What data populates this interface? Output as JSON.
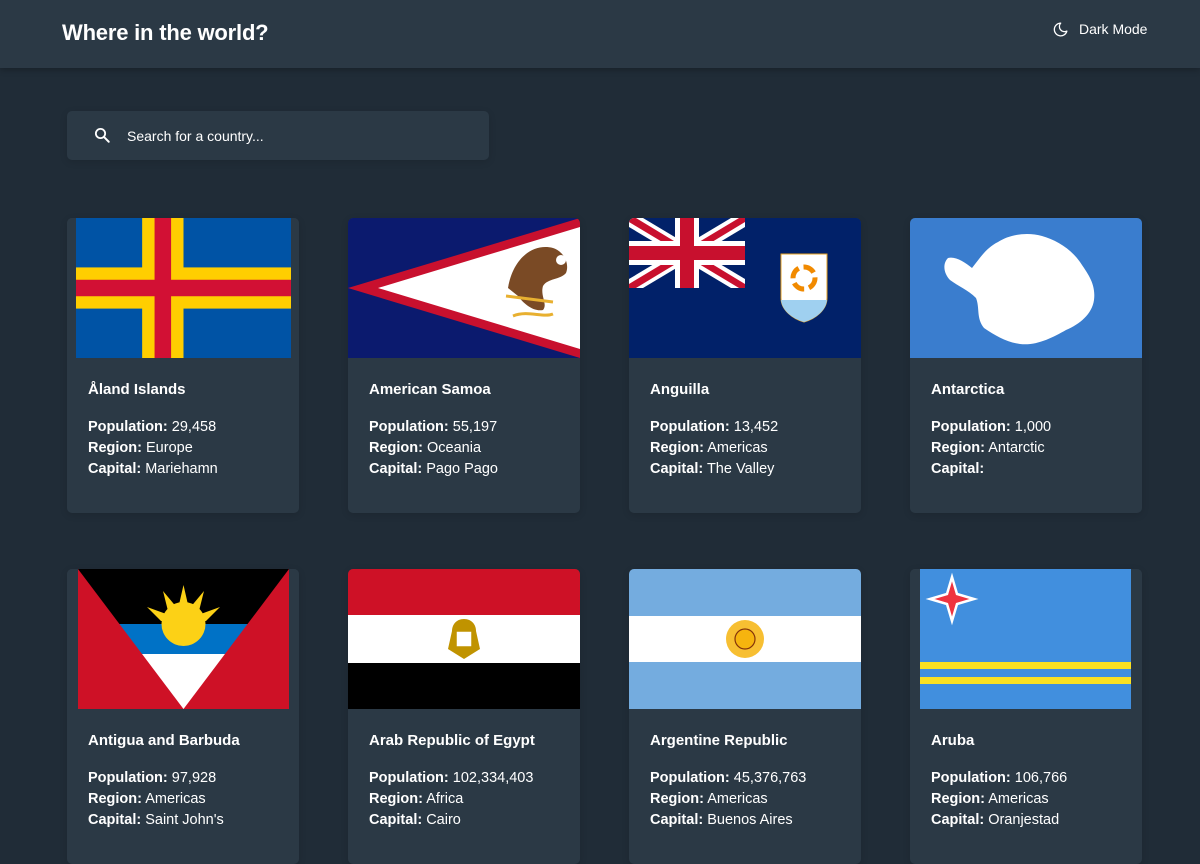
{
  "header": {
    "title": "Where in the world?",
    "mode_label": "Dark Mode",
    "mode_icon": "moon-icon"
  },
  "search": {
    "placeholder": "Search for a country...",
    "value": "",
    "icon": "search-icon"
  },
  "labels": {
    "population": "Population:",
    "region": "Region:",
    "capital": "Capital:"
  },
  "colors": {
    "background": "#202c37",
    "elements": "#2b3945",
    "text": "#ffffff"
  },
  "countries": [
    {
      "name": "Åland Islands",
      "population": "29,458",
      "region": "Europe",
      "capital": "Mariehamn",
      "flag": "aland-flag"
    },
    {
      "name": "American Samoa",
      "population": "55,197",
      "region": "Oceania",
      "capital": "Pago Pago",
      "flag": "american-samoa-flag"
    },
    {
      "name": "Anguilla",
      "population": "13,452",
      "region": "Americas",
      "capital": "The Valley",
      "flag": "anguilla-flag"
    },
    {
      "name": "Antarctica",
      "population": "1,000",
      "region": "Antarctic",
      "capital": "",
      "flag": "antarctica-flag"
    },
    {
      "name": "Antigua and Barbuda",
      "population": "97,928",
      "region": "Americas",
      "capital": "Saint John's",
      "flag": "antigua-barbuda-flag"
    },
    {
      "name": "Arab Republic of Egypt",
      "population": "102,334,403",
      "region": "Africa",
      "capital": "Cairo",
      "flag": "egypt-flag"
    },
    {
      "name": "Argentine Republic",
      "population": "45,376,763",
      "region": "Americas",
      "capital": "Buenos Aires",
      "flag": "argentina-flag"
    },
    {
      "name": "Aruba",
      "population": "106,766",
      "region": "Americas",
      "capital": "Oranjestad",
      "flag": "aruba-flag"
    }
  ]
}
